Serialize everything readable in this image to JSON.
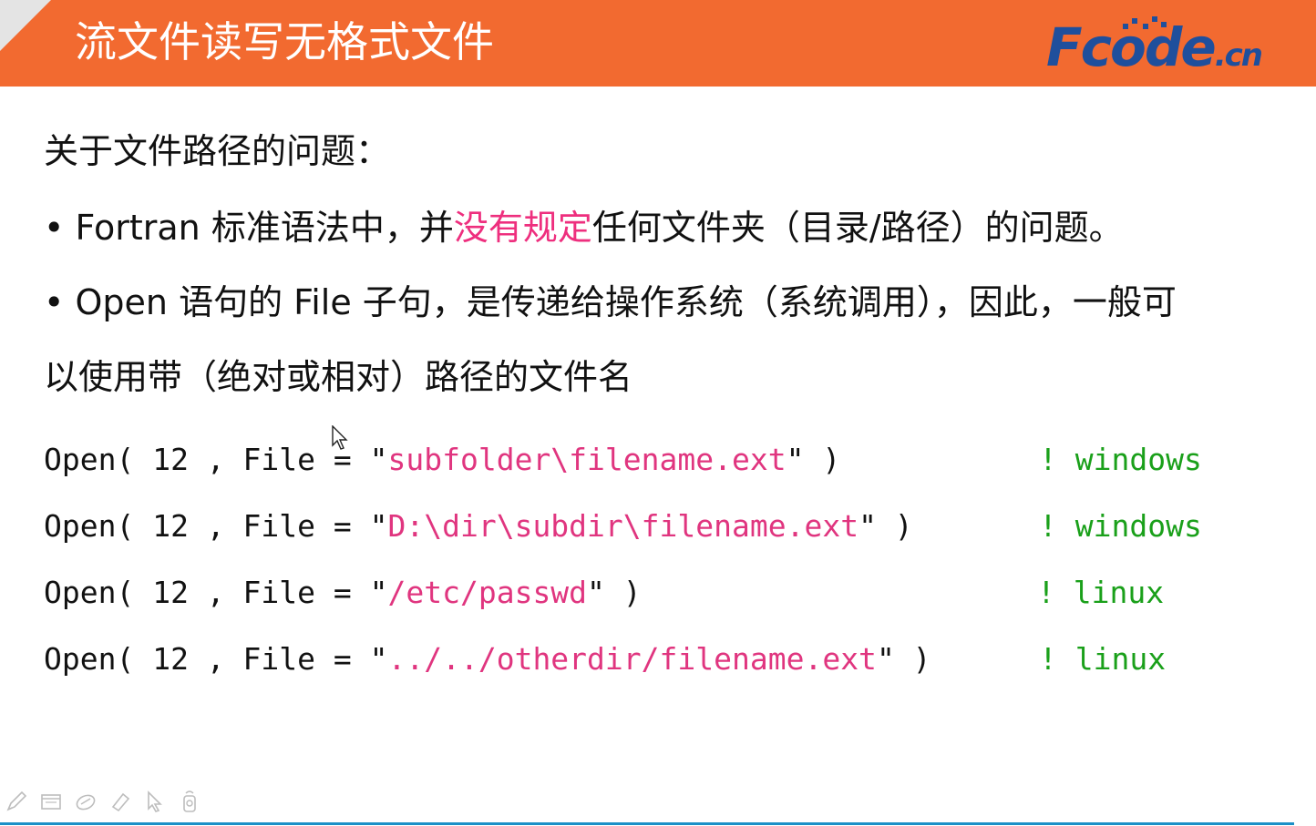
{
  "header": {
    "title": "流文件读写无格式文件",
    "logo_main": "Fcode",
    "logo_suffix": ".cn"
  },
  "content": {
    "intro": "关于文件路径的问题：",
    "bullet1": {
      "prefix": "• Fortran 标准语法中，并",
      "highlight": "没有规定",
      "suffix": "任何文件夹（目录/路径）的问题。"
    },
    "bullet2_line1": "• Open 语句的 File 子句，是传递给操作系统（系统调用），因此，一般可",
    "bullet2_line2": "以使用带（绝对或相对）路径的文件名"
  },
  "code_lines": [
    {
      "pre": "Open( 12 , File = \"",
      "str": "subfolder\\filename.ext",
      "post": "\" )",
      "comment": "! windows"
    },
    {
      "pre": "Open( 12 , File = \"",
      "str": "D:\\dir\\subdir\\filename.ext",
      "post": "\" )",
      "comment": "! windows"
    },
    {
      "pre": "Open( 12 , File = \"",
      "str": "/etc/passwd",
      "post": "\" )",
      "comment": "! linux"
    },
    {
      "pre": "Open( 12 , File = \"",
      "str": "../../otherdir/filename.ext",
      "post": "\" )",
      "comment": "! linux"
    }
  ],
  "colors": {
    "header_bg": "#f26a30",
    "highlight": "#ee2f7e",
    "string": "#e0357f",
    "comment": "#1aa01a",
    "logo": "#1f4f9c"
  },
  "toolbar_icons": [
    "pen-icon",
    "slides-icon",
    "eraser-icon",
    "highlighter-icon",
    "pointer-icon",
    "laser-icon"
  ]
}
